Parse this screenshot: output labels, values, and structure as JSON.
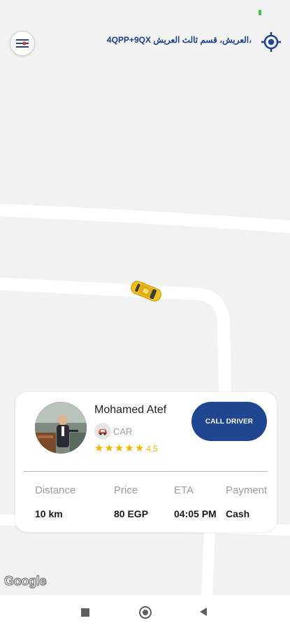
{
  "map": {
    "address": "4QPP+9QX العريش، قسم ثالث العريش،",
    "attribution": "Google"
  },
  "icons": {
    "menu": "menu-icon",
    "locate": "my-location-icon",
    "vehicle": "taxi-car-marker",
    "vehicle_type_icon": "car-icon"
  },
  "driver": {
    "name": "Mohamed Atef",
    "vehicle_type": "CAR",
    "rating": "4.5",
    "stars": 5,
    "call_button_label": "CALL DRIVER"
  },
  "trip": {
    "distance_label": "Distance",
    "distance_value": "10 km",
    "price_label": "Price",
    "price_value": "80 EGP",
    "eta_label": "ETA",
    "eta_value": "04:05 PM",
    "payment_label": "Payment",
    "payment_value": "Cash"
  },
  "colors": {
    "accent": "#1f4791",
    "star": "#f5b300",
    "map_background": "#f2f2f2",
    "road": "#ffffff"
  }
}
